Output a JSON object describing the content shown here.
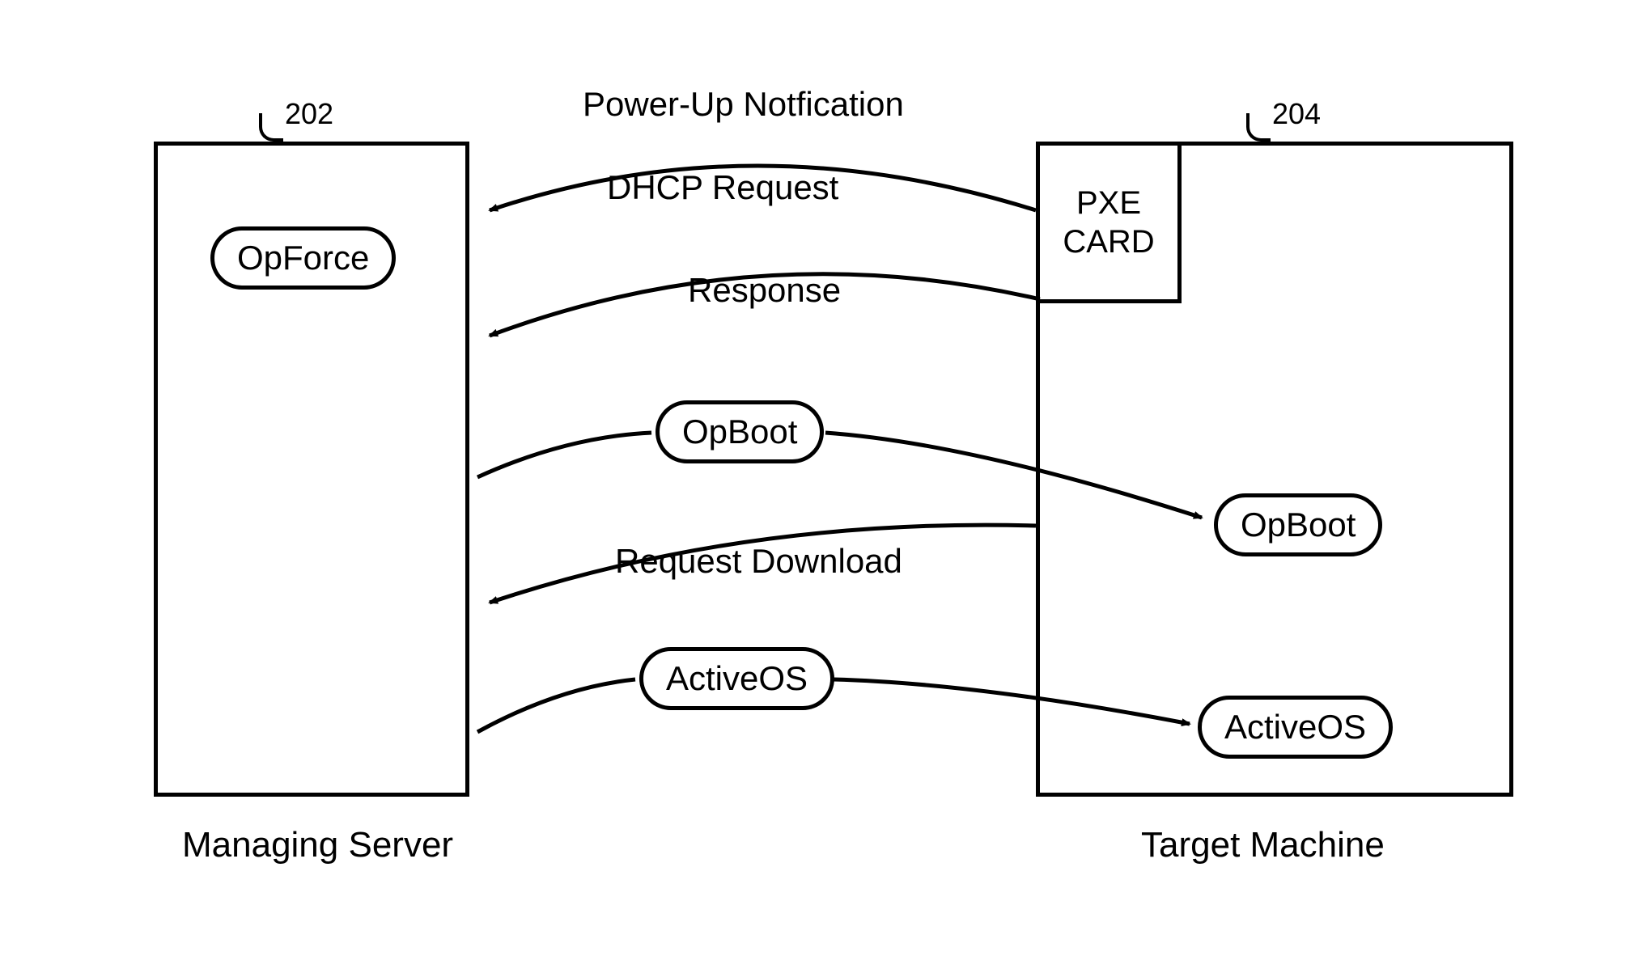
{
  "refs": {
    "left": "202",
    "right": "204"
  },
  "boxes": {
    "pxe_card": "PXE CARD",
    "opforce": "OpForce",
    "opboot_mid": "OpBoot",
    "opboot_right": "OpBoot",
    "activeos_mid": "ActiveOS",
    "activeos_right": "ActiveOS"
  },
  "captions": {
    "left": "Managing Server",
    "right": "Target Machine"
  },
  "messages": {
    "powerup": "Power-Up Notfication",
    "dhcp": "DHCP Request",
    "response": "Response",
    "request_download": "Request Download"
  }
}
